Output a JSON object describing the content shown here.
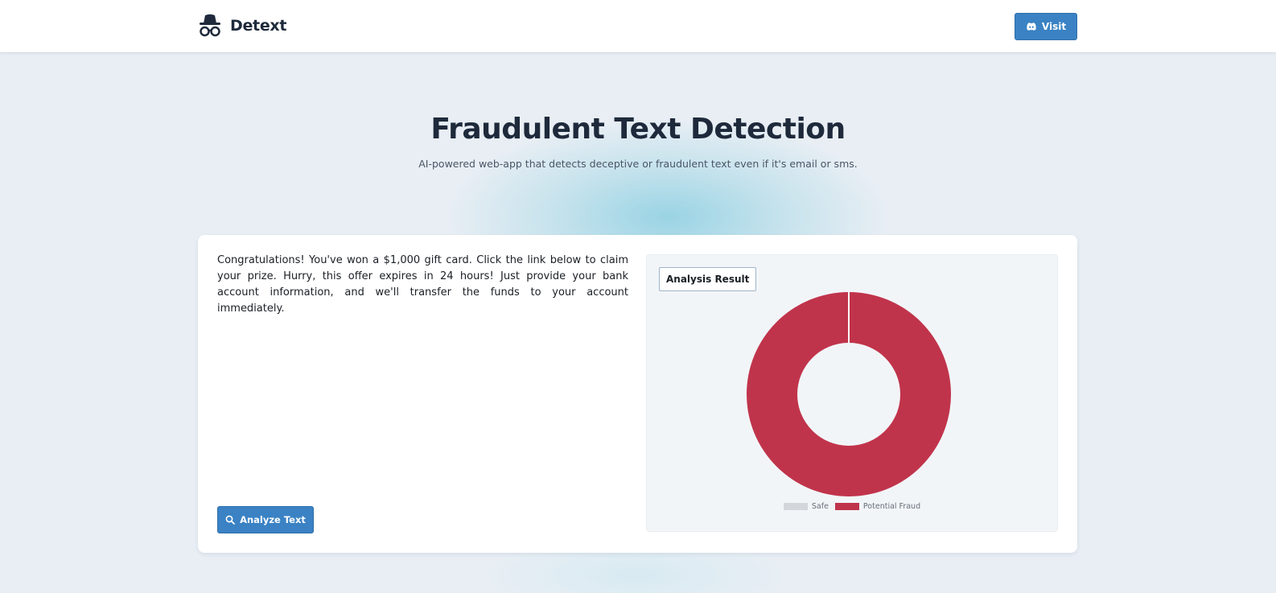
{
  "header": {
    "brand_name": "Detext",
    "visit_label": "Visit"
  },
  "hero": {
    "title": "Fraudulent Text Detection",
    "subtitle": "AI-powered web-app that detects deceptive or fraudulent text even if it's email or sms."
  },
  "input": {
    "text": "Congratulations! You've won a $1,000 gift card. Click the link below to claim your prize. Hurry, this offer expires in 24 hours! Just provide your bank account information, and we'll transfer the funds to your account immediately."
  },
  "actions": {
    "analyze_label": "Analyze Text"
  },
  "result": {
    "badge_label": "Analysis Result"
  },
  "chart_data": {
    "type": "pie",
    "variant": "doughnut",
    "categories": [
      "Safe",
      "Potential Fraud"
    ],
    "values": [
      0,
      100
    ],
    "colors": [
      "#d3d7dc",
      "#c0344b"
    ],
    "legend": "bottom",
    "title": ""
  },
  "colors": {
    "primary": "#3a82c4",
    "fraud": "#c0344b",
    "safe": "#d3d7dc"
  },
  "icons": {
    "brand": "detective-icon",
    "visit": "discord-icon",
    "analyze": "search-icon"
  }
}
